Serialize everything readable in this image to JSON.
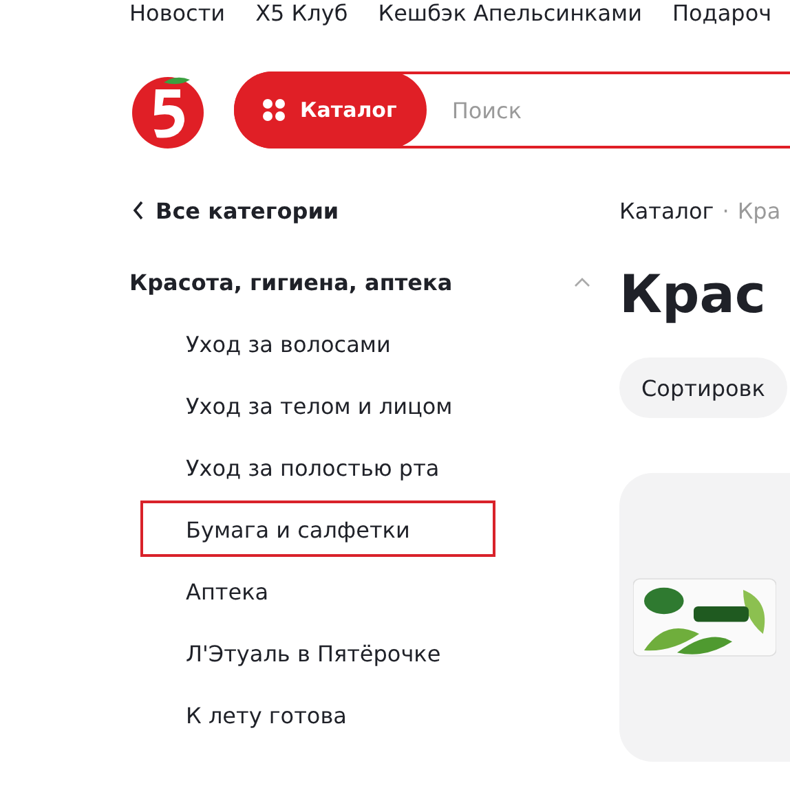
{
  "top_nav": [
    "Новости",
    "X5 Клуб",
    "Кешбэк Апельсинками",
    "Подароч"
  ],
  "header": {
    "catalog_button": "Каталог",
    "search": {
      "placeholder": "Поиск"
    }
  },
  "sidebar": {
    "back_link": "Все категории",
    "category": {
      "title": "Красота, гигиена, аптека",
      "expanded": true,
      "items": [
        {
          "label": "Уход за волосами",
          "highlighted": false
        },
        {
          "label": "Уход за телом и лицом",
          "highlighted": false
        },
        {
          "label": "Уход за полостью рта",
          "highlighted": false
        },
        {
          "label": "Бумага и салфетки",
          "highlighted": true
        },
        {
          "label": "Аптека",
          "highlighted": false
        },
        {
          "label": "Л'Этуаль в Пятёрочке",
          "highlighted": false
        },
        {
          "label": "К лету готова",
          "highlighted": false
        }
      ]
    }
  },
  "breadcrumbs": {
    "separator": "·",
    "items": [
      "Каталог",
      "Кра"
    ]
  },
  "page_title": "Крас",
  "sort_button": "Сортировк"
}
